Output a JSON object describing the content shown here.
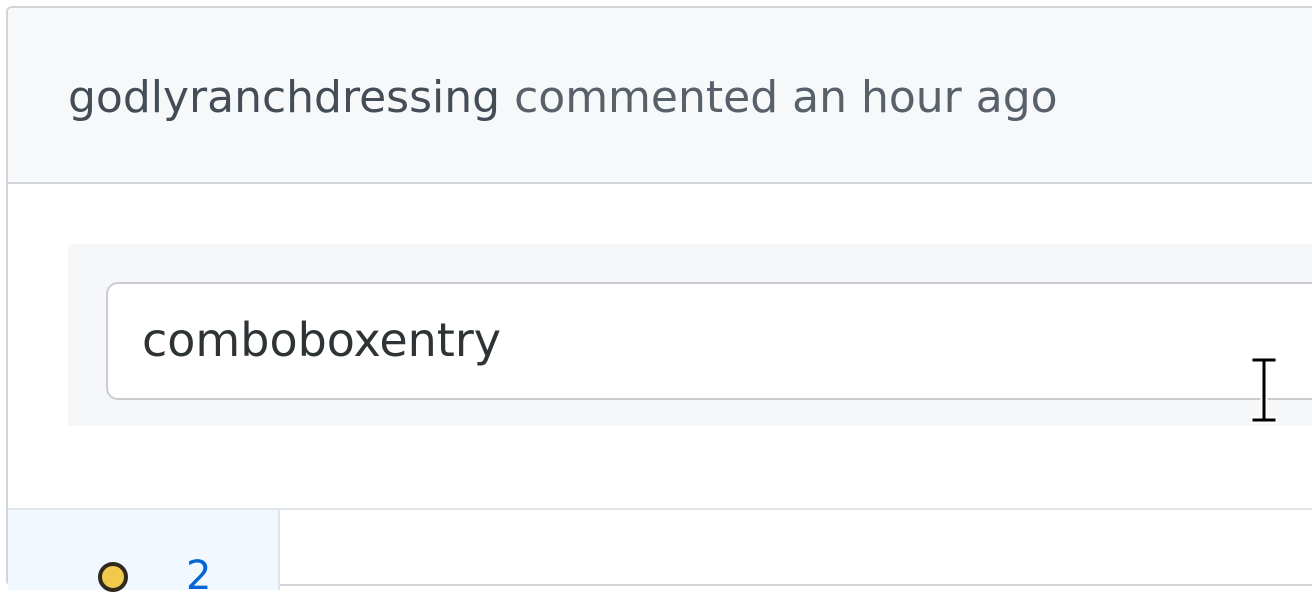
{
  "comment": {
    "author": "godlyranchdressing",
    "action": "commented",
    "time": "an hour ago"
  },
  "widget": {
    "entry_value": "comboboxentry"
  },
  "reactions": {
    "count": "2",
    "emoji_icon": "emoji-icon"
  },
  "cursor": {
    "icon": "text-cursor-icon"
  },
  "colors": {
    "header_bg": "#f6f8fa",
    "border": "#d1d5da",
    "header_text": "#586069",
    "entry_text": "#2e3436",
    "reaction_bg": "#f1f8ff",
    "link_blue": "#0366d6"
  }
}
